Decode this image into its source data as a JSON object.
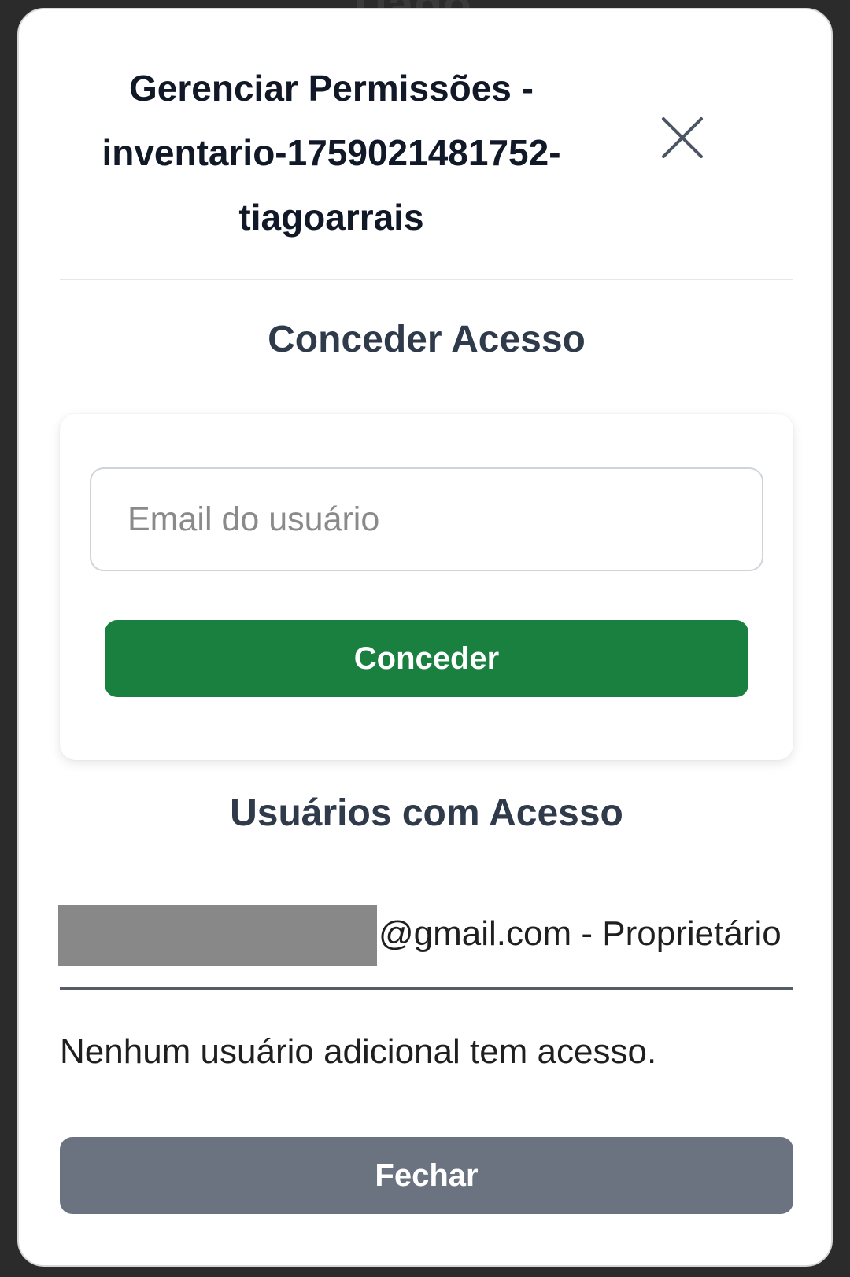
{
  "backdrop": {
    "text_fragment": "Tiago"
  },
  "modal": {
    "title": "Gerenciar Permissões - inventario-1759021481752-tiagoarrais",
    "close_icon": "close-icon"
  },
  "grant_section": {
    "title": "Conceder Acesso",
    "email_placeholder": "Email do usuário",
    "email_value": "",
    "grant_button_label": "Conceder",
    "grant_button_color": "#1a8040"
  },
  "users_section": {
    "title": "Usuários com Acesso",
    "owner": {
      "email_suffix": "@gmail.com - Proprietário"
    },
    "empty_message": "Nenhum usuário adicional tem acesso."
  },
  "footer": {
    "close_button_label": "Fechar",
    "close_button_color": "#6b7380"
  }
}
